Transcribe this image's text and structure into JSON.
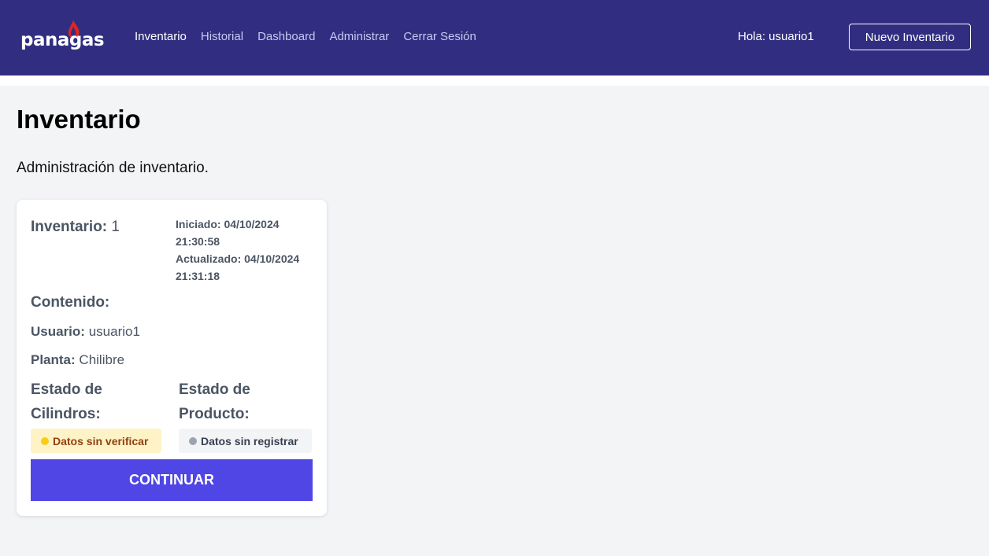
{
  "brand": {
    "logo_text": "panagas",
    "primary_color": "#312e81",
    "accent_color": "#4f46e5",
    "flame_color": "#dc2626"
  },
  "nav": {
    "links": [
      {
        "label": "Inventario",
        "active": true
      },
      {
        "label": "Historial",
        "active": false
      },
      {
        "label": "Dashboard",
        "active": false
      },
      {
        "label": "Administrar",
        "active": false
      },
      {
        "label": "Cerrar Sesión",
        "active": false
      }
    ],
    "greeting": "Hola: usuario1",
    "new_button": "Nuevo Inventario"
  },
  "page": {
    "title": "Inventario",
    "subtitle": "Administración de inventario."
  },
  "card": {
    "inventory_label": "Inventario:",
    "inventory_number": "1",
    "started_line1": "Iniciado: 04/10/2024",
    "started_line2": "21:30:58",
    "updated_line1": "Actualizado: 04/10/2024",
    "updated_line2": "21:31:18",
    "contenido_label": "Contenido:",
    "usuario_label": "Usuario:",
    "usuario_value": "usuario1",
    "planta_label": "Planta:",
    "planta_value": "Chilibre",
    "cilindros_status_label": "Estado de Cilindros:",
    "producto_status_label": "Estado de Producto:",
    "cilindros_badge": "Datos sin verificar",
    "cilindros_badge_color": "#facc15",
    "producto_badge": "Datos sin registrar",
    "producto_badge_color": "#9ca3af",
    "continue_button": "CONTINUAR"
  }
}
